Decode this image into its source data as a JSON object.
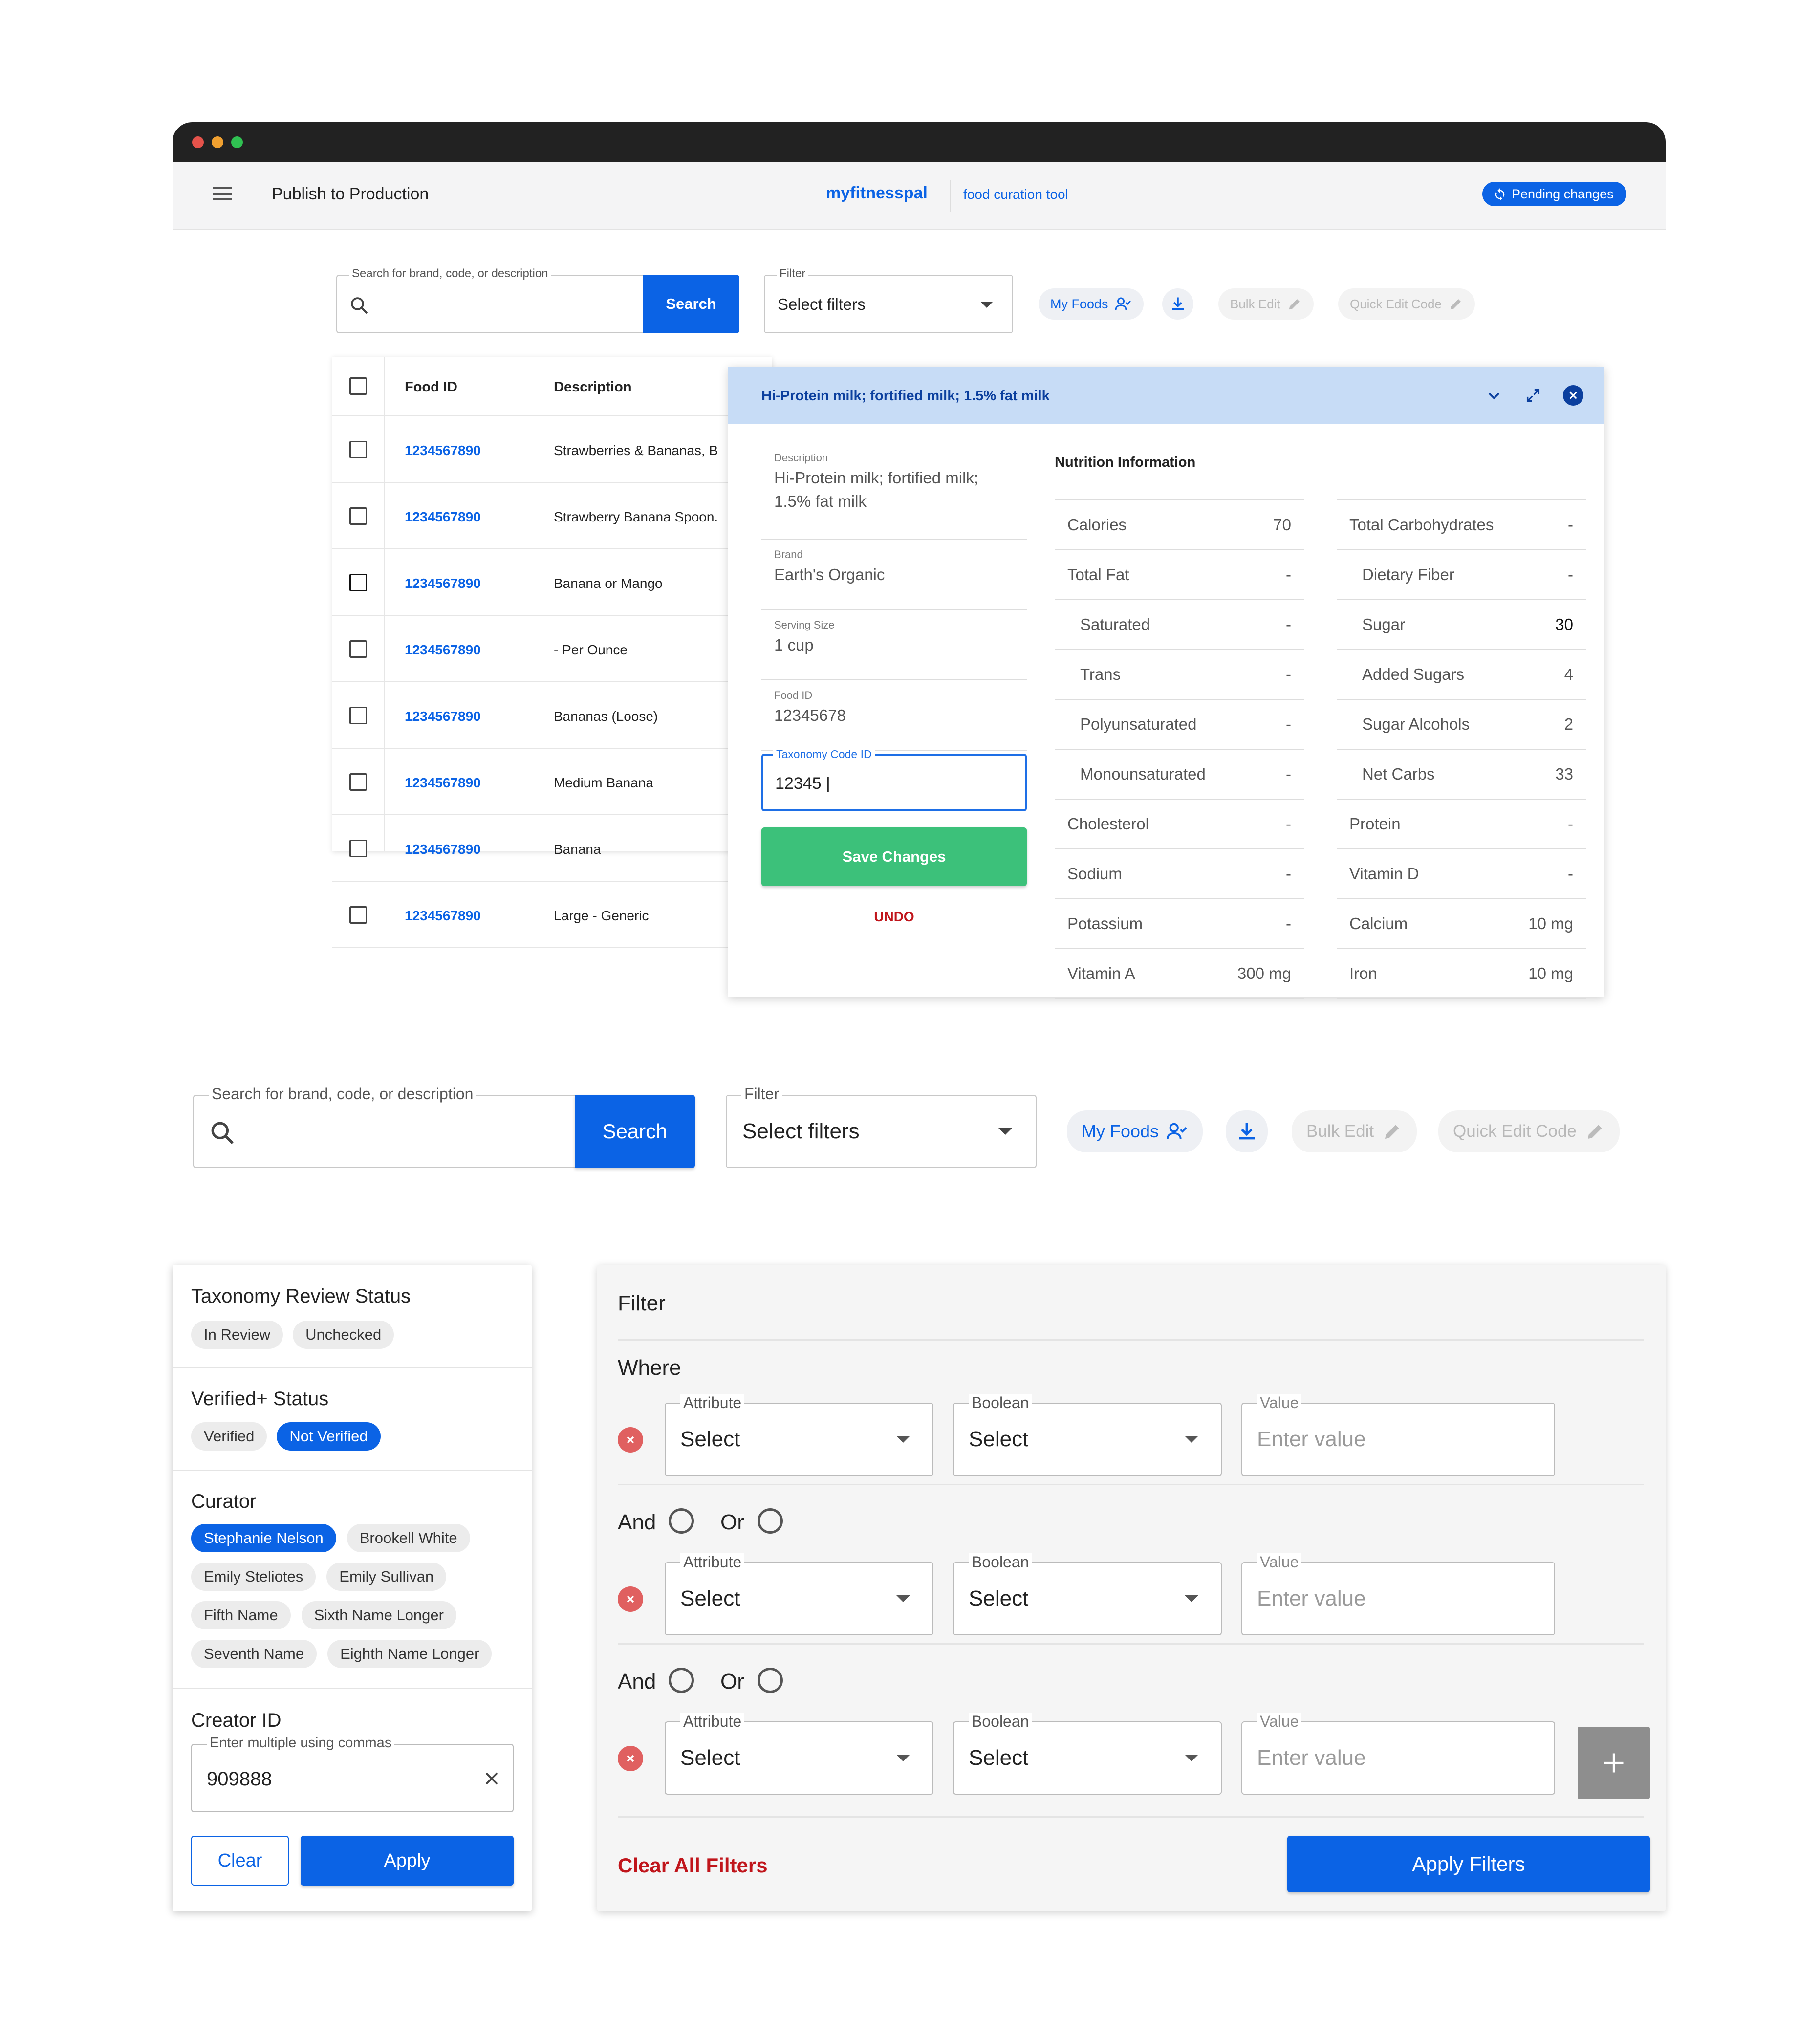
{
  "header": {
    "app_title": "Publish to Production",
    "brand": "myfitnesspal",
    "tool_name": "food curation tool",
    "pending_label": "Pending changes"
  },
  "toolbar": {
    "search_label": "Search for brand, code, or description",
    "search_button": "Search",
    "filter_label": "Filter",
    "filter_value": "Select filters",
    "my_foods": "My Foods",
    "bulk_edit": "Bulk Edit",
    "quick_edit": "Quick Edit Code"
  },
  "table": {
    "col_food_id": "Food ID",
    "col_description": "Description",
    "rows": [
      {
        "id": "1234567890",
        "desc": "Strawberries & Bananas, B"
      },
      {
        "id": "1234567890",
        "desc": "Strawberry Banana Spoon."
      },
      {
        "id": "1234567890",
        "desc": "Banana or Mango"
      },
      {
        "id": "1234567890",
        "desc": "- Per Ounce"
      },
      {
        "id": "1234567890",
        "desc": "Bananas (Loose)"
      },
      {
        "id": "1234567890",
        "desc": "Medium Banana"
      },
      {
        "id": "1234567890",
        "desc": "Banana"
      },
      {
        "id": "1234567890",
        "desc": "Large - Generic"
      }
    ]
  },
  "detail": {
    "title": "Hi-Protein milk; fortified milk; 1.5% fat milk",
    "fields": [
      {
        "label": "Description",
        "value": "Hi-Protein milk; fortified milk; 1.5% fat milk"
      },
      {
        "label": "Brand",
        "value": "Earth's Organic"
      },
      {
        "label": "Serving Size",
        "value": "1 cup"
      },
      {
        "label": "Food ID",
        "value": "12345678"
      }
    ],
    "taxonomy_label": "Taxonomy Code ID",
    "taxonomy_value": "12345 |",
    "save_button": "Save Changes",
    "undo": "UNDO",
    "nutrition_title": "Nutrition Information",
    "nutrition_left": [
      {
        "name": "Calories",
        "value": "70"
      },
      {
        "name": "Total Fat",
        "value": "-"
      },
      {
        "name": "Saturated",
        "value": "-"
      },
      {
        "name": "Trans",
        "value": "-"
      },
      {
        "name": "Polyunsaturated",
        "value": "-"
      },
      {
        "name": "Monounsaturated",
        "value": "-"
      },
      {
        "name": "Cholesterol",
        "value": "-"
      },
      {
        "name": "Sodium",
        "value": "-"
      },
      {
        "name": "Potassium",
        "value": "-"
      },
      {
        "name": "Vitamin A",
        "value": "300 mg"
      }
    ],
    "nutrition_right": [
      {
        "name": "Total Carbohydrates",
        "value": "-"
      },
      {
        "name": "Dietary Fiber",
        "value": "-"
      },
      {
        "name": "Sugar",
        "value": "30"
      },
      {
        "name": "Added Sugars",
        "value": "4"
      },
      {
        "name": "Sugar Alcohols",
        "value": "2"
      },
      {
        "name": "Net Carbs",
        "value": "33"
      },
      {
        "name": "Protein",
        "value": "-"
      },
      {
        "name": "Vitamin D",
        "value": "-"
      },
      {
        "name": "Calcium",
        "value": "10 mg"
      },
      {
        "name": "Iron",
        "value": "10 mg"
      }
    ]
  },
  "quick_filters": {
    "taxonomy_title": "Taxonomy Review Status",
    "taxonomy_chips": [
      "In Review",
      "Unchecked"
    ],
    "verified_title": "Verified+ Status",
    "verified_chips": [
      "Verified",
      "Not Verified"
    ],
    "curator_title": "Curator",
    "curator_chips": [
      "Stephanie Nelson",
      "Brookell White",
      "Emily Steliotes",
      "Emily Sullivan",
      "Fifth Name",
      "Sixth Name Longer",
      "Seventh Name",
      "Eighth Name Longer"
    ],
    "creator_title": "Creator ID",
    "creator_label": "Enter multiple using commas",
    "creator_value": "909888",
    "clear": "Clear",
    "apply": "Apply"
  },
  "filter_builder": {
    "title": "Filter",
    "where": "Where",
    "and": "And",
    "or": "Or",
    "attribute_label": "Attribute",
    "boolean_label": "Boolean",
    "value_label": "Value",
    "select": "Select",
    "value_placeholder": "Enter value",
    "clear_all": "Clear All Filters",
    "apply_filters": "Apply Filters"
  },
  "colors": {
    "primary": "#0b63e5",
    "success": "#3cc17a",
    "danger": "#c0151b",
    "panel_header": "#c7dcf6"
  }
}
